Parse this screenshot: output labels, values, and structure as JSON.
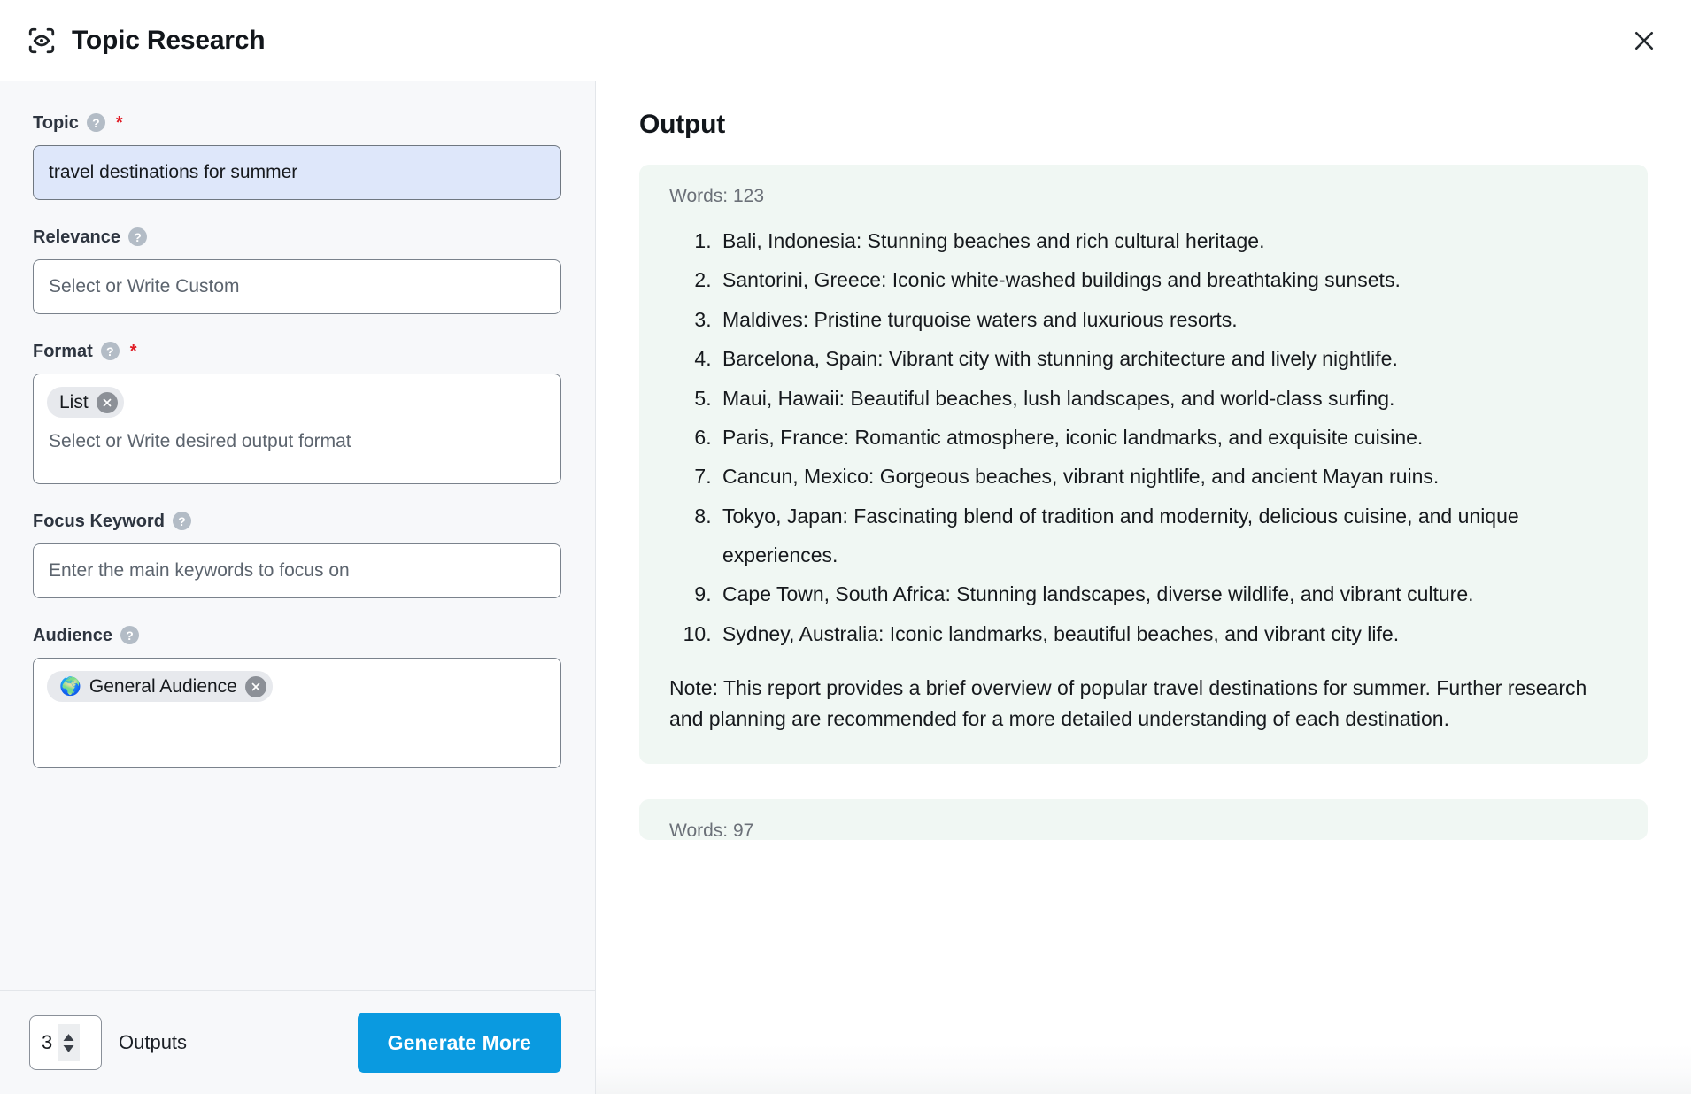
{
  "header": {
    "title": "Topic Research",
    "icon": "scan-eye-icon",
    "close_icon": "close-icon"
  },
  "form": {
    "fields": [
      {
        "label": "Topic",
        "help": "?",
        "required": true,
        "value": "travel destinations for summer",
        "placeholder": ""
      },
      {
        "label": "Relevance",
        "help": "?",
        "required": false,
        "value": "",
        "placeholder": "Select or Write Custom"
      },
      {
        "label": "Format",
        "help": "?",
        "required": true,
        "chips": [
          {
            "label": "List",
            "emoji": ""
          }
        ],
        "placeholder": "Select or Write desired output format"
      },
      {
        "label": "Focus Keyword",
        "help": "?",
        "required": false,
        "value": "",
        "placeholder": "Enter the main keywords to focus on"
      },
      {
        "label": "Audience",
        "help": "?",
        "required": false,
        "chips": [
          {
            "label": "General Audience",
            "emoji": "🌍"
          }
        ],
        "placeholder": ""
      }
    ]
  },
  "footer": {
    "outputs_value": "3",
    "outputs_label": "Outputs",
    "generate_label": "Generate More"
  },
  "output": {
    "title": "Output",
    "cards": [
      {
        "words_label": "Words: 123",
        "items": [
          "Bali, Indonesia: Stunning beaches and rich cultural heritage.",
          "Santorini, Greece: Iconic white-washed buildings and breathtaking sunsets.",
          "Maldives: Pristine turquoise waters and luxurious resorts.",
          "Barcelona, Spain: Vibrant city with stunning architecture and lively nightlife.",
          "Maui, Hawaii: Beautiful beaches, lush landscapes, and world-class surfing.",
          "Paris, France: Romantic atmosphere, iconic landmarks, and exquisite cuisine.",
          "Cancun, Mexico: Gorgeous beaches, vibrant nightlife, and ancient Mayan ruins.",
          "Tokyo, Japan: Fascinating blend of tradition and modernity, delicious cuisine, and unique experiences.",
          "Cape Town, South Africa: Stunning landscapes, diverse wildlife, and vibrant culture.",
          "Sydney, Australia: Iconic landmarks, beautiful beaches, and vibrant city life."
        ],
        "note": "Note: This report provides a brief overview of popular travel destinations for summer. Further research and planning are recommended for a more detailed understanding of each destination."
      },
      {
        "words_label": "Words: 97",
        "items": [],
        "note": ""
      }
    ]
  },
  "colors": {
    "accent": "#0a9ae0",
    "required_star": "#e01b24",
    "panel_bg": "#f7f8fa",
    "card_bg": "#f0f7f3",
    "focused_input_bg": "#dee7fa"
  }
}
